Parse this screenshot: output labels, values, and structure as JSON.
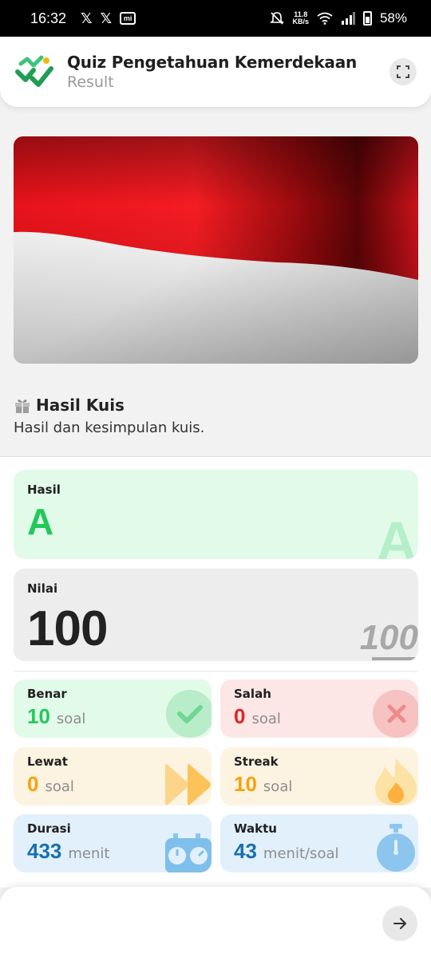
{
  "status_bar": {
    "time": "16:32",
    "net_speed_value": "11.8",
    "net_speed_unit": "KB/s",
    "battery": "58%"
  },
  "header": {
    "title": "Quiz Pengetahuan Kemerdekaan",
    "subtitle": "Result"
  },
  "section": {
    "title": "Hasil Kuis",
    "description": "Hasil dan kesimpulan kuis."
  },
  "result": {
    "hasil_label": "Hasil",
    "hasil_value": "A",
    "nilai_label": "Nilai",
    "nilai_value": "100",
    "nilai_deco": "100"
  },
  "stats": {
    "benar": {
      "label": "Benar",
      "value": "10",
      "unit": "soal"
    },
    "salah": {
      "label": "Salah",
      "value": "0",
      "unit": "soal"
    },
    "lewat": {
      "label": "Lewat",
      "value": "0",
      "unit": "soal"
    },
    "streak": {
      "label": "Streak",
      "value": "10",
      "unit": "soal"
    },
    "durasi": {
      "label": "Durasi",
      "value": "433",
      "unit": "menit"
    },
    "waktu": {
      "label": "Waktu",
      "value": "43",
      "unit": "menit/soal"
    }
  },
  "colors": {
    "green": "#22c85a",
    "red": "#e02424",
    "orange": "#f5a30a",
    "blue": "#1a6fb0"
  }
}
